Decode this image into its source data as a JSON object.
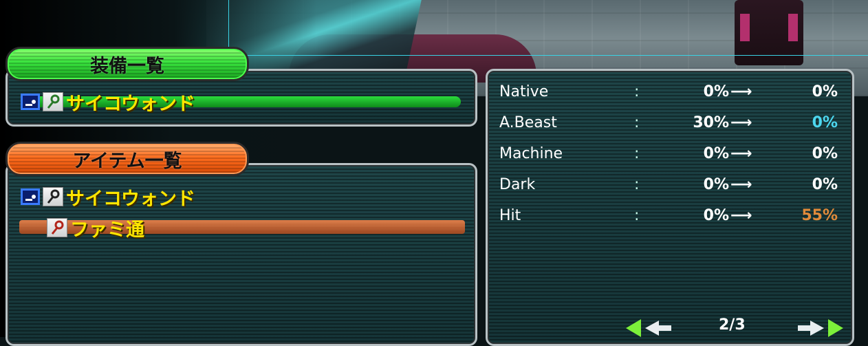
{
  "colors": {
    "item_name": "#ffe600",
    "stat_text": "#ffffff",
    "stat_up_cyan": "#4dd8f0",
    "stat_up_orange": "#e08a3a"
  },
  "equipment_panel": {
    "title": "装備一覧",
    "items": [
      {
        "name": "サイコウォンド",
        "equipped_icon": "equipped-icon",
        "type_icon": "wand-icon",
        "highlighted": true
      }
    ]
  },
  "item_panel": {
    "title": "アイテム一覧",
    "items": [
      {
        "name": "サイコウォンド",
        "equipped_icon": "equipped-icon",
        "type_icon": "wand-icon",
        "highlighted": false
      },
      {
        "name": "ファミ通",
        "type_icon": "wand-icon",
        "highlighted": true
      }
    ]
  },
  "stats": [
    {
      "label": "Native",
      "sep": ":",
      "from": "0%",
      "arrow": "⟶",
      "to": "0%",
      "to_color": "#ffffff"
    },
    {
      "label": "A.Beast",
      "sep": ":",
      "from": "30%",
      "arrow": "⟶",
      "to": "0%",
      "to_color": "#4dd8f0"
    },
    {
      "label": "Machine",
      "sep": ":",
      "from": "0%",
      "arrow": "⟶",
      "to": "0%",
      "to_color": "#ffffff"
    },
    {
      "label": "Dark",
      "sep": ":",
      "from": "0%",
      "arrow": "⟶",
      "to": "0%",
      "to_color": "#ffffff"
    },
    {
      "label": "Hit",
      "sep": ":",
      "from": "0%",
      "arrow": "⟶",
      "to": "55%",
      "to_color": "#e08a3a"
    }
  ],
  "pager": {
    "page": "2/3",
    "prev_icon": "arrow-left-icon",
    "next_icon": "arrow-right-icon"
  }
}
